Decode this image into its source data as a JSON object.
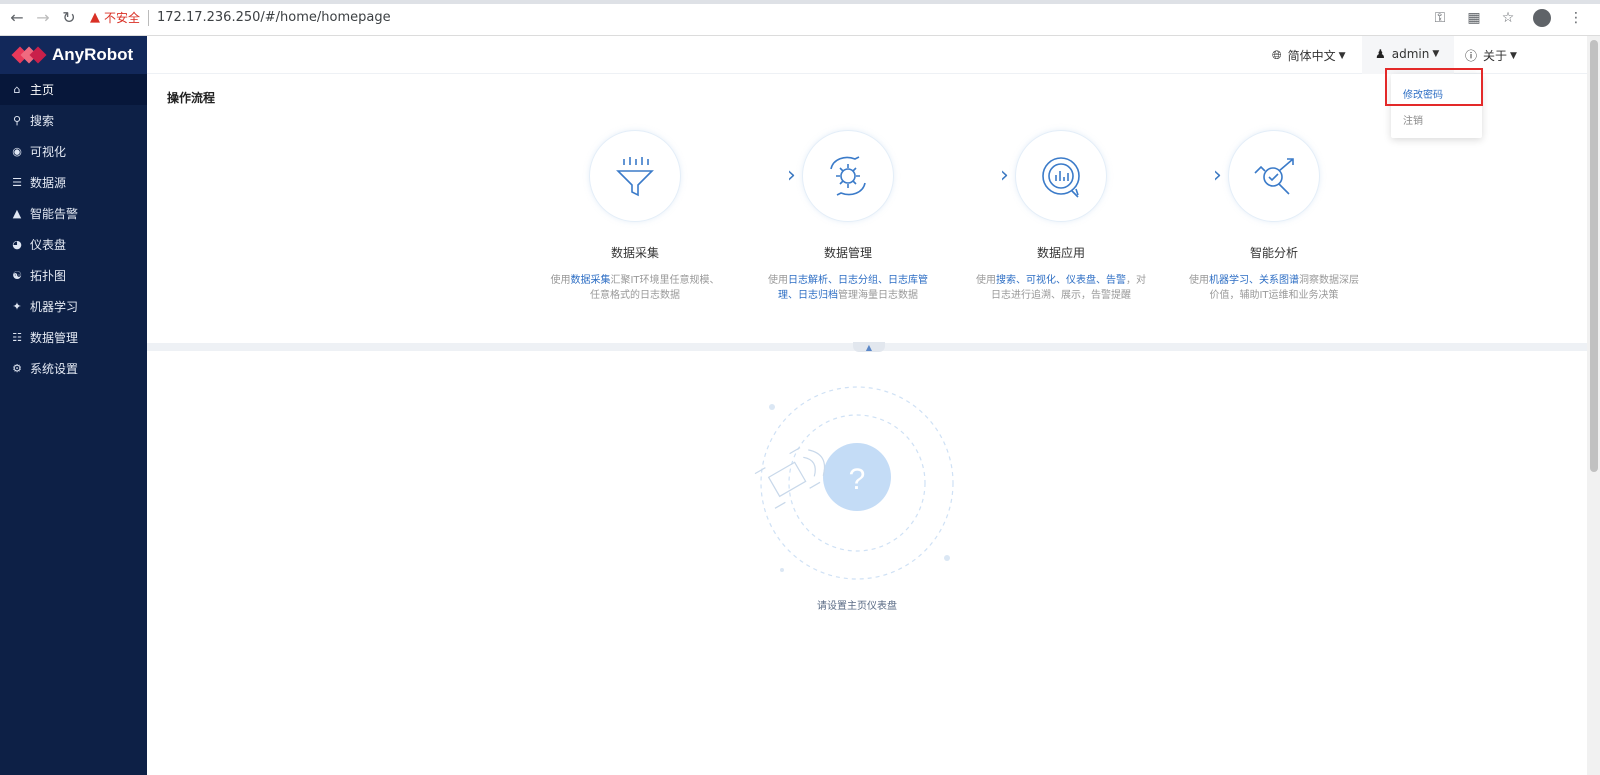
{
  "browser": {
    "insecure_label": "不安全",
    "url": "172.17.236.250/#/home/homepage"
  },
  "app": {
    "logo_text": "AnyRobot"
  },
  "sidebar": {
    "items": [
      {
        "label": "主页",
        "icon": "home-icon",
        "active": true
      },
      {
        "label": "搜索",
        "icon": "search-icon"
      },
      {
        "label": "可视化",
        "icon": "eye-icon"
      },
      {
        "label": "数据源",
        "icon": "database-icon"
      },
      {
        "label": "智能告警",
        "icon": "warning-icon"
      },
      {
        "label": "仪表盘",
        "icon": "gauge-icon"
      },
      {
        "label": "拓扑图",
        "icon": "topology-icon"
      },
      {
        "label": "机器学习",
        "icon": "ml-icon"
      },
      {
        "label": "数据管理",
        "icon": "data-manage-icon"
      },
      {
        "label": "系统设置",
        "icon": "gear-icon"
      }
    ]
  },
  "header": {
    "language": "简体中文",
    "user": "admin",
    "about": "关于"
  },
  "dropdown": {
    "change_password": "修改密码",
    "logout": "注销"
  },
  "main": {
    "section_title": "操作流程",
    "steps": [
      {
        "title": "数据采集",
        "icon": "funnel-icon",
        "desc_parts": [
          [
            "使用",
            false
          ],
          [
            "数据采集",
            true
          ],
          [
            "汇聚IT环境里任意规模、任意格式的日志数据",
            false
          ]
        ]
      },
      {
        "title": "数据管理",
        "icon": "gear-cycle-icon",
        "desc_parts": [
          [
            "使用",
            false
          ],
          [
            "日志解析、日志分组、日志库管理、日志归档",
            true
          ],
          [
            "管理海量日志数据",
            false
          ]
        ]
      },
      {
        "title": "数据应用",
        "icon": "chart-refresh-icon",
        "desc_parts": [
          [
            "使用",
            false
          ],
          [
            "搜索、可视化、仪表盘、告警",
            true
          ],
          [
            "，对日志进行追溯、展示，告警提醒",
            false
          ]
        ]
      },
      {
        "title": "智能分析",
        "icon": "target-analysis-icon",
        "desc_parts": [
          [
            "使用",
            false
          ],
          [
            "机器学习、关系图谱",
            true
          ],
          [
            "洞察数据深层价值，辅助IT运维和业务决策",
            false
          ]
        ]
      }
    ],
    "empty_text": "请设置主页仪表盘"
  }
}
